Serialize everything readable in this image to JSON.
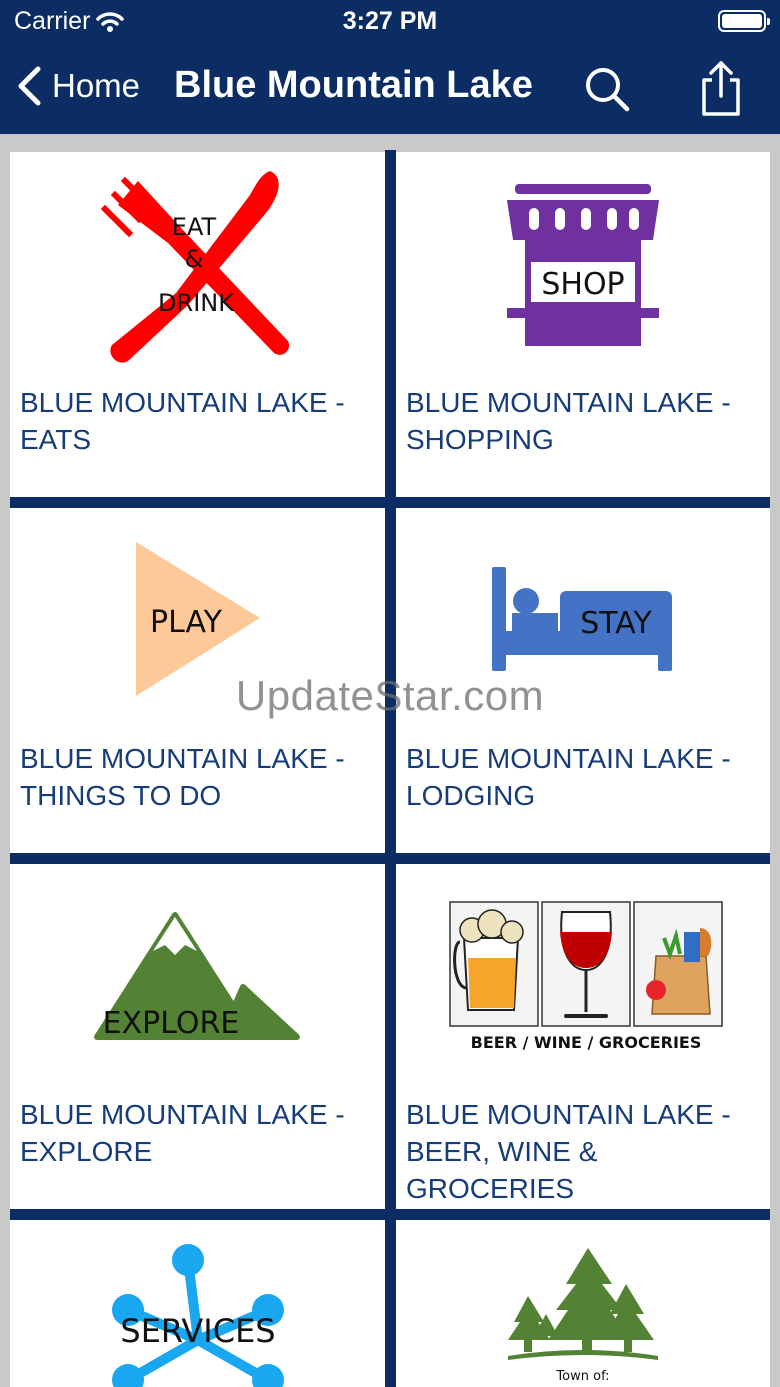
{
  "status_bar": {
    "carrier": "Carrier",
    "time": "3:27 PM"
  },
  "nav": {
    "back_label": "Home",
    "title": "Blue Mountain Lake",
    "icons": [
      "chevron-left-icon",
      "search-icon",
      "share-icon"
    ]
  },
  "tiles": [
    {
      "label": "BLUE MOUNTAIN LAKE - EATS",
      "icon_text": [
        "EAT",
        "&",
        "DRINK"
      ],
      "icon": "fork-knife-icon",
      "color": "#ff0000"
    },
    {
      "label": "BLUE MOUNTAIN LAKE - SHOPPING",
      "icon_text": "SHOP",
      "icon": "storefront-icon",
      "color": "#7030a0"
    },
    {
      "label": "BLUE MOUNTAIN LAKE - THINGS TO DO",
      "icon_text": "PLAY",
      "icon": "play-triangle-icon",
      "color": "#fdc999"
    },
    {
      "label": "BLUE MOUNTAIN LAKE - LODGING",
      "icon_text": "STAY",
      "icon": "bed-icon",
      "color": "#4472c4"
    },
    {
      "label": "BLUE MOUNTAIN LAKE - EXPLORE",
      "icon_text": "EXPLORE",
      "icon": "mountain-icon",
      "color": "#548235"
    },
    {
      "label": "BLUE MOUNTAIN LAKE - BEER, WINE & GROCERIES",
      "icon_text": "BEER / WINE / GROCERIES",
      "icon": "beer-wine-groceries-icon",
      "color": "#000000"
    },
    {
      "label": "",
      "icon_text": "SERVICES",
      "icon": "network-icon",
      "color": "#18a7f0"
    },
    {
      "label": "",
      "icon_text": "Town of:",
      "icon": "pine-trees-icon",
      "color": "#548235"
    }
  ],
  "watermark": "UpdateStar.com",
  "colors": {
    "nav_background": "#0b2d63",
    "label_text": "#173c7a",
    "grid_background": "#c9c9c9"
  }
}
